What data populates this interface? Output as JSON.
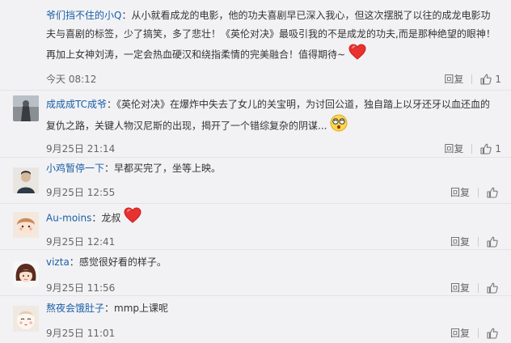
{
  "comments": [
    {
      "user": "爷们挡不住的小Q",
      "colon": "：",
      "text": "从小就看成龙的电影，他的功夫喜剧早已深入我心，但这次摆脱了以往的成龙电影功夫与喜剧的标签，少了搞笑，多了悲壮！《英伦对决》最吸引我的不是成龙的功夫,而是那种绝望的眼神！再加上女神刘涛，一定会热血硬汉和绕指柔情的完美融合！值得期待~",
      "emoji": "heart",
      "time": "今天 08:12",
      "reply": "回复",
      "likes": "1"
    },
    {
      "user": "成成成TC成爷",
      "colon": "：",
      "text": "《英伦对决》在爆炸中失去了女儿的关宝明，为讨回公道，独自踏上以牙还牙以血还血的复仇之路，关键人物汉尼斯的出现，揭开了一个错综复杂的阴谋...",
      "emoji": "dizzy-face",
      "time": "9月25日 21:14",
      "reply": "回复",
      "likes": "1"
    },
    {
      "user": "小鸡暂停一下",
      "colon": "：",
      "text": "早都买完了，坐等上映。",
      "emoji": "",
      "time": "9月25日 12:55",
      "reply": "回复",
      "likes": ""
    },
    {
      "user": "Au-moins",
      "colon": "：",
      "text": "龙叔",
      "emoji": "heart",
      "time": "9月25日 12:41",
      "reply": "回复",
      "likes": ""
    },
    {
      "user": "vizta",
      "colon": "：",
      "text": "感觉很好看的样子。",
      "emoji": "",
      "time": "9月25日 11:56",
      "reply": "回复",
      "likes": ""
    },
    {
      "user": "熬夜会饿肚子",
      "colon": "：",
      "text": "mmp上课呢",
      "emoji": "",
      "time": "9月25日 11:01",
      "reply": "回复",
      "likes": ""
    }
  ],
  "icons": {
    "like": "thumbs-up-icon",
    "heart": "heart-icon",
    "dizzy": "dizzy-face-icon"
  },
  "colors": {
    "username": "#1a5ea5",
    "heart": "#e8322f",
    "background": "#f2f2f5"
  }
}
